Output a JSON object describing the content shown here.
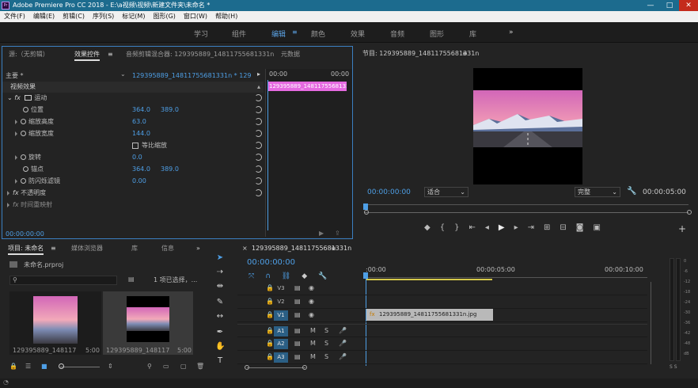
{
  "titlebar": {
    "app_icon": "Pr",
    "title": "Adobe Premiere Pro CC 2018 - E:\\a视频\\视频\\新建文件夹\\未命名 *",
    "min": "—",
    "max": "□",
    "close": "✕"
  },
  "menu": [
    "文件(F)",
    "编辑(E)",
    "剪辑(C)",
    "序列(S)",
    "标记(M)",
    "图形(G)",
    "窗口(W)",
    "帮助(H)"
  ],
  "workspaces": [
    "学习",
    "组件",
    "编辑",
    "颜色",
    "效果",
    "音频",
    "图形",
    "库"
  ],
  "workspace_more": "»",
  "effect_panel": {
    "tabs": [
      "源:（无剪辑）",
      "效果控件",
      "音频剪辑混合器: 129395889_14811755681331n",
      "元数据"
    ],
    "master": "主要 * 129395889_14811755681331n.jpg",
    "seq": "129395889_14811755681331n * 129395889_...",
    "t0": "00:00",
    "t1": "00:00",
    "clip": "129395889_14811755681331n.jpg",
    "video_effects": "视频效果",
    "motion": "运动",
    "position": "位置",
    "pos_x": "364.0",
    "pos_y": "389.0",
    "scale_h": "缩放高度",
    "scale_h_val": "63.0",
    "scale_w": "缩放宽度",
    "scale_w_val": "144.0",
    "uniform": "等比缩放",
    "rotation": "旋转",
    "rotation_val": "0.0",
    "anchor": "锚点",
    "anchor_x": "364.0",
    "anchor_y": "389.0",
    "flicker": "防闪烁滤镜",
    "flicker_val": "0.00",
    "opacity": "不透明度",
    "remap": "时间重映射",
    "timecode": "00:00:00:00"
  },
  "program": {
    "title": "节目: 129395889_14811755681331n",
    "timecode": "00:00:00:00",
    "fit": "适合",
    "quality": "完整",
    "duration": "00:00:05:00"
  },
  "project": {
    "tabs": [
      "项目: 未命名",
      "媒体浏览器",
      "库",
      "信息"
    ],
    "file": "未命名.prproj",
    "selected": "1 项已选择，...",
    "item1_name": "129395889_148117556...",
    "item1_dur": "5:00",
    "item2_name": "129395889_148117556...",
    "item2_dur": "5:00"
  },
  "timeline": {
    "tab": "129395889_14811755681331n",
    "timecode": "00:00:00:00",
    "t0": ":00:00",
    "t1": "00:00:05:00",
    "t2": "00:00:10:00",
    "tracks": [
      "V3",
      "V2",
      "V1",
      "A1",
      "A2",
      "A3"
    ],
    "clip": "129395889_14811755681331n.jpg",
    "fx": "fx"
  },
  "meter": {
    "labels": [
      "0",
      "-6",
      "-12",
      "-18",
      "-24",
      "-30",
      "-36",
      "-42",
      "-48",
      "dB"
    ],
    "solo": "S S"
  },
  "colors": {
    "accent": "#4e9fe6",
    "title": "#1c6b8e",
    "clip_fx": "#e56ae0",
    "clip": "#b9b9b9"
  }
}
